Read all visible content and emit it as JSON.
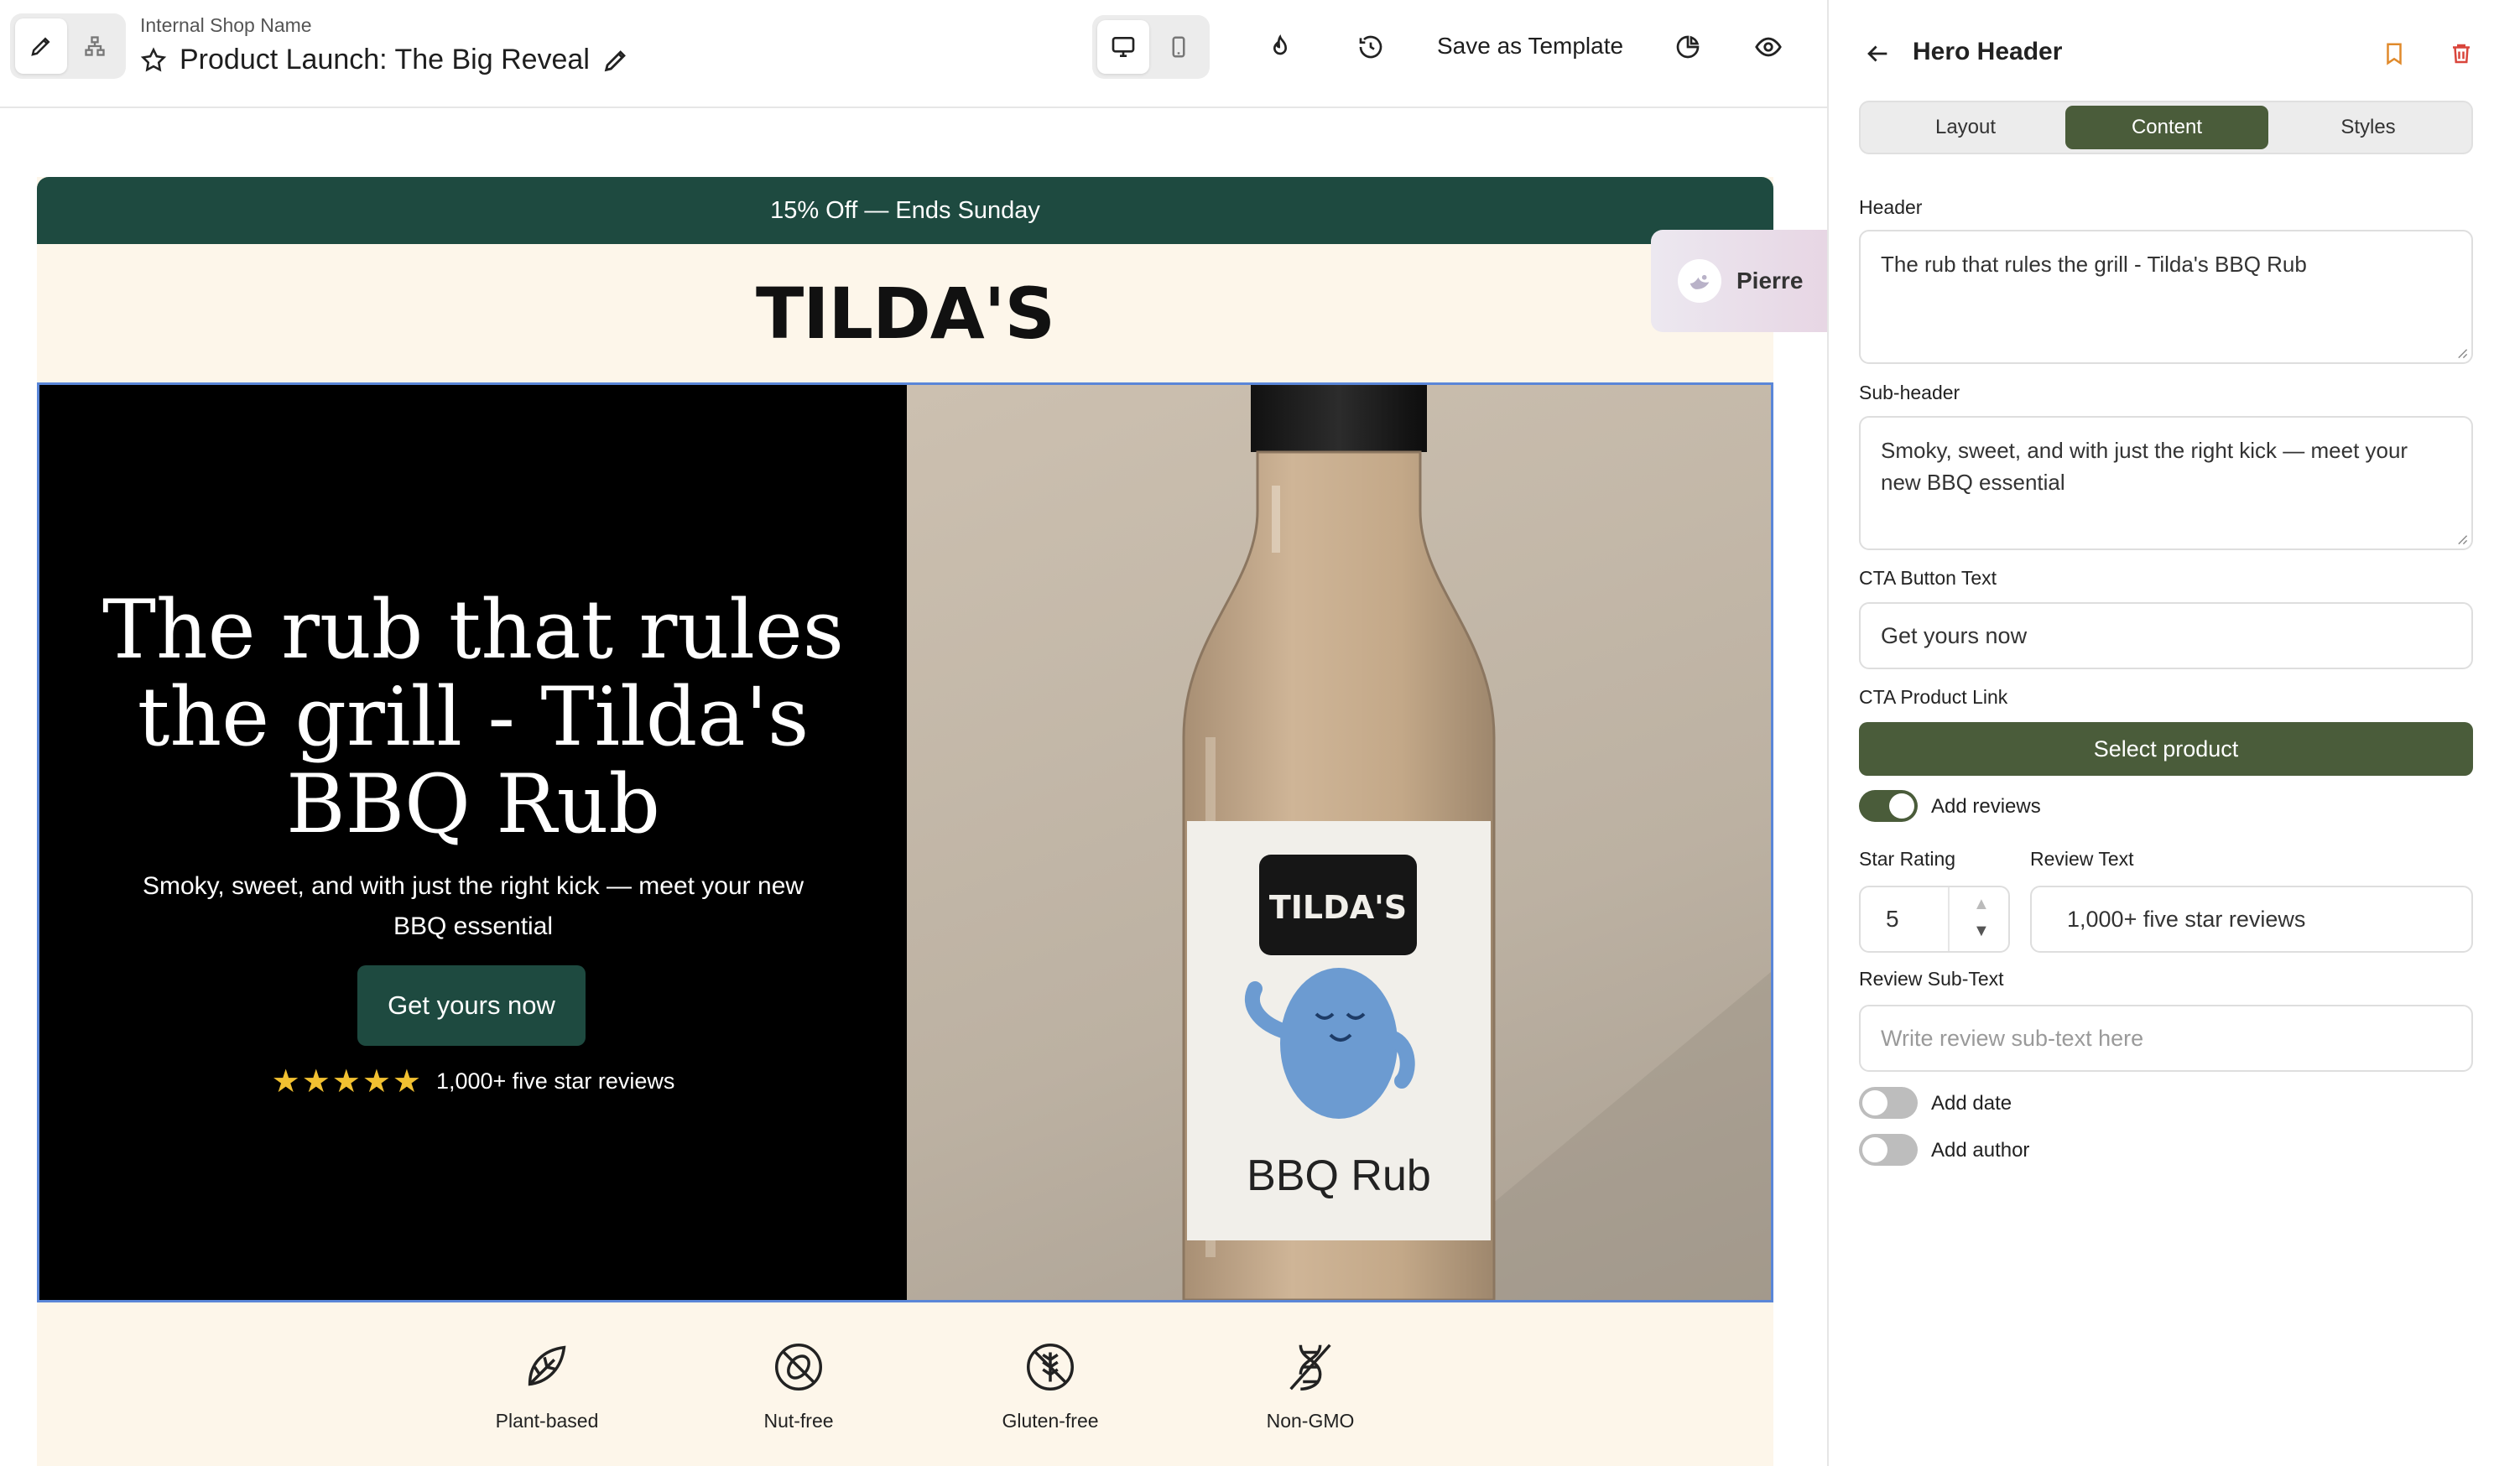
{
  "topbar": {
    "shop_name": "Internal Shop Name",
    "campaign_title": "Product Launch: The Big Reveal",
    "save_template_label": "Save as Template",
    "icons": [
      "pencil-icon",
      "sitemap-icon",
      "star-icon",
      "edit-icon",
      "desktop-icon",
      "mobile-icon",
      "flame-icon",
      "history-icon",
      "pie-chart-icon",
      "eye-icon"
    ]
  },
  "collaborator": {
    "name": "Pierre"
  },
  "email": {
    "promo_text": "15% Off — Ends Sunday",
    "brand": "TILDA'S",
    "hero": {
      "title": "The rub that rules the grill - Tilda's BBQ Rub",
      "subtitle": "Smoky, sweet, and with just the right kick — meet your new BBQ essential",
      "cta": "Get yours now",
      "stars": "★★★★★",
      "star_rating": 5,
      "review_text": "1,000+ five star reviews",
      "product_label_brand": "TILDA'S",
      "product_label_name": "BBQ Rub"
    },
    "badges": [
      {
        "label": "Plant-based",
        "icon": "leaf-icon"
      },
      {
        "label": "Nut-free",
        "icon": "no-nut-icon"
      },
      {
        "label": "Gluten-free",
        "icon": "no-gluten-icon"
      },
      {
        "label": "Non-GMO",
        "icon": "non-gmo-icon"
      }
    ]
  },
  "panel": {
    "title": "Hero Header",
    "tabs": [
      {
        "label": "Layout",
        "active": false
      },
      {
        "label": "Content",
        "active": true
      },
      {
        "label": "Styles",
        "active": false
      }
    ],
    "header_label": "Header",
    "header_value": "The rub that rules the grill - Tilda's BBQ Rub",
    "subheader_label": "Sub-header",
    "subheader_value": "Smoky, sweet, and with just the right kick — meet your new BBQ essential",
    "cta_text_label": "CTA Button Text",
    "cta_text_value": "Get yours now",
    "cta_link_label": "CTA Product Link",
    "select_product_label": "Select product",
    "add_reviews_label": "Add reviews",
    "add_reviews_on": true,
    "star_rating_label": "Star Rating",
    "star_rating_value": "5",
    "review_text_label": "Review Text",
    "review_text_value": "1,000+ five star reviews",
    "review_subtext_label": "Review Sub-Text",
    "review_subtext_placeholder": "Write review sub-text here",
    "add_date_label": "Add date",
    "add_date_on": false,
    "add_author_label": "Add author",
    "add_author_on": false
  },
  "colors": {
    "brand_green": "#1e4a40",
    "panel_accent": "#4a5c3a",
    "cream": "#fdf6ea",
    "selection_blue": "#5a86d8",
    "star_yellow": "#f2c131",
    "bookmark_orange": "#e08a2b",
    "delete_red": "#d9453b"
  }
}
